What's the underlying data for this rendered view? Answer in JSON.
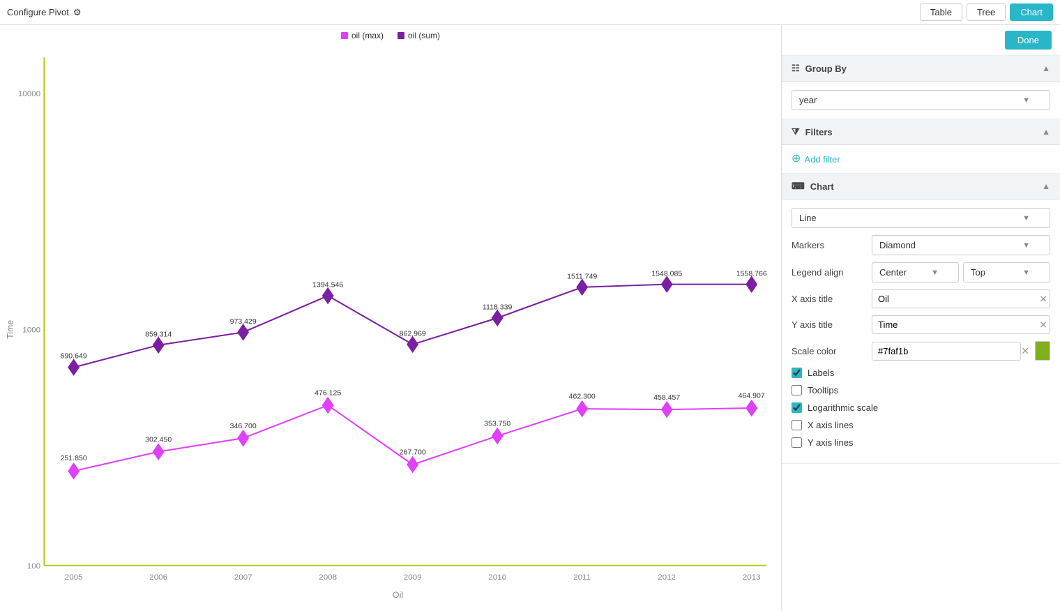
{
  "topbar": {
    "configure_label": "Configure Pivot",
    "table_label": "Table",
    "tree_label": "Tree",
    "chart_label": "Chart"
  },
  "sidebar": {
    "done_label": "Done",
    "group_by": {
      "title": "Group By",
      "selected": "year"
    },
    "filters": {
      "title": "Filters",
      "add_filter_label": "Add filter"
    },
    "chart": {
      "title": "Chart",
      "chart_type": "Line",
      "markers_label": "Markers",
      "markers_value": "Diamond",
      "legend_align_label": "Legend align",
      "legend_align_h": "Center",
      "legend_align_v": "Top",
      "x_axis_title_label": "X axis title",
      "x_axis_title_value": "Oil",
      "y_axis_title_label": "Y axis title",
      "y_axis_title_value": "Time",
      "scale_color_label": "Scale color",
      "scale_color_value": "#7faf1b",
      "labels_label": "Labels",
      "labels_checked": true,
      "tooltips_label": "Tooltips",
      "tooltips_checked": false,
      "log_scale_label": "Logarithmic scale",
      "log_scale_checked": true,
      "x_axis_lines_label": "X axis lines",
      "x_axis_lines_checked": false,
      "y_axis_lines_label": "Y axis lines",
      "y_axis_lines_checked": false
    }
  },
  "legend": {
    "items": [
      {
        "label": "oil (max)",
        "color": "#e040fb"
      },
      {
        "label": "oil (sum)",
        "color": "#7b1fa2"
      }
    ]
  },
  "chart": {
    "x_label": "Oil",
    "y_label": "Time",
    "years": [
      "2005",
      "2006",
      "2007",
      "2008",
      "2009",
      "2010",
      "2011",
      "2012",
      "2013"
    ],
    "sum_values": [
      690.649,
      859.314,
      973.429,
      1394.546,
      862.969,
      1118.339,
      1511.749,
      1548.085,
      1558.766
    ],
    "max_values": [
      251.85,
      302.45,
      346.7,
      476.125,
      267.7,
      353.75,
      462.3,
      458.457,
      464.907
    ],
    "y_ticks": [
      "10000",
      "",
      "",
      "",
      "1000",
      "",
      "",
      "",
      "100"
    ],
    "sum_color": "#7b1fa2",
    "max_color": "#e040fb"
  }
}
